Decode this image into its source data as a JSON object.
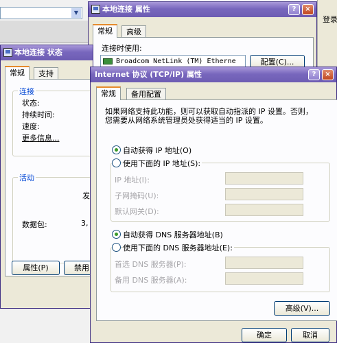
{
  "desktop": {
    "right_sidebar_label": "登录"
  },
  "properties_window": {
    "title": "本地连接 属性",
    "help_btn": "?",
    "close_btn": "×",
    "tabs": [
      "常规",
      "高级"
    ],
    "connect_using_label": "连接时使用:",
    "adapter_name": "Broadcom NetLink (TM) Etherne",
    "configure_btn": "配置(C)..."
  },
  "status_window": {
    "title": "本地连接 状态",
    "tabs": [
      "常规",
      "支持"
    ],
    "connection_group": "连接",
    "status_label": "状态:",
    "duration_label": "持续时间:",
    "speed_label": "速度:",
    "more_info_link": "更多信息...",
    "activity_group": "活动",
    "sent_label_partial": "发",
    "packets_label": "数据包:",
    "packets_value_partial": "3,",
    "properties_btn": "属性(P)",
    "disable_btn_partial": "禁用"
  },
  "tcpip_window": {
    "title": "Internet 协议 (TCP/IP) 属性",
    "help_btn": "?",
    "close_btn": "×",
    "tabs": [
      "常规",
      "备用配置"
    ],
    "description_line1": "如果网络支持此功能，则可以获取自动指派的 IP 设置。否则，",
    "description_line2": "您需要从网络系统管理员处获得适当的 IP 设置。",
    "auto_ip_radio": "自动获得 IP 地址(O)",
    "manual_ip_radio": "使用下面的 IP 地址(S):",
    "ip_address_label": "IP 地址(I):",
    "subnet_mask_label": "子网掩码(U):",
    "default_gateway_label": "默认网关(D):",
    "auto_dns_radio": "自动获得 DNS 服务器地址(B)",
    "manual_dns_radio": "使用下面的 DNS 服务器地址(E):",
    "preferred_dns_label": "首选 DNS 服务器(P):",
    "alternate_dns_label": "备用 DNS 服务器(A):",
    "advanced_btn": "高级(V)...",
    "ok_btn": "确定",
    "cancel_btn": "取消",
    "auto_ip_selected": true,
    "auto_dns_selected": true
  },
  "colors": {
    "titlebar": "#7867bd",
    "window_bg": "#ece9d8",
    "panel_bg": "#fcfcfe",
    "group_title": "#0046d5"
  }
}
